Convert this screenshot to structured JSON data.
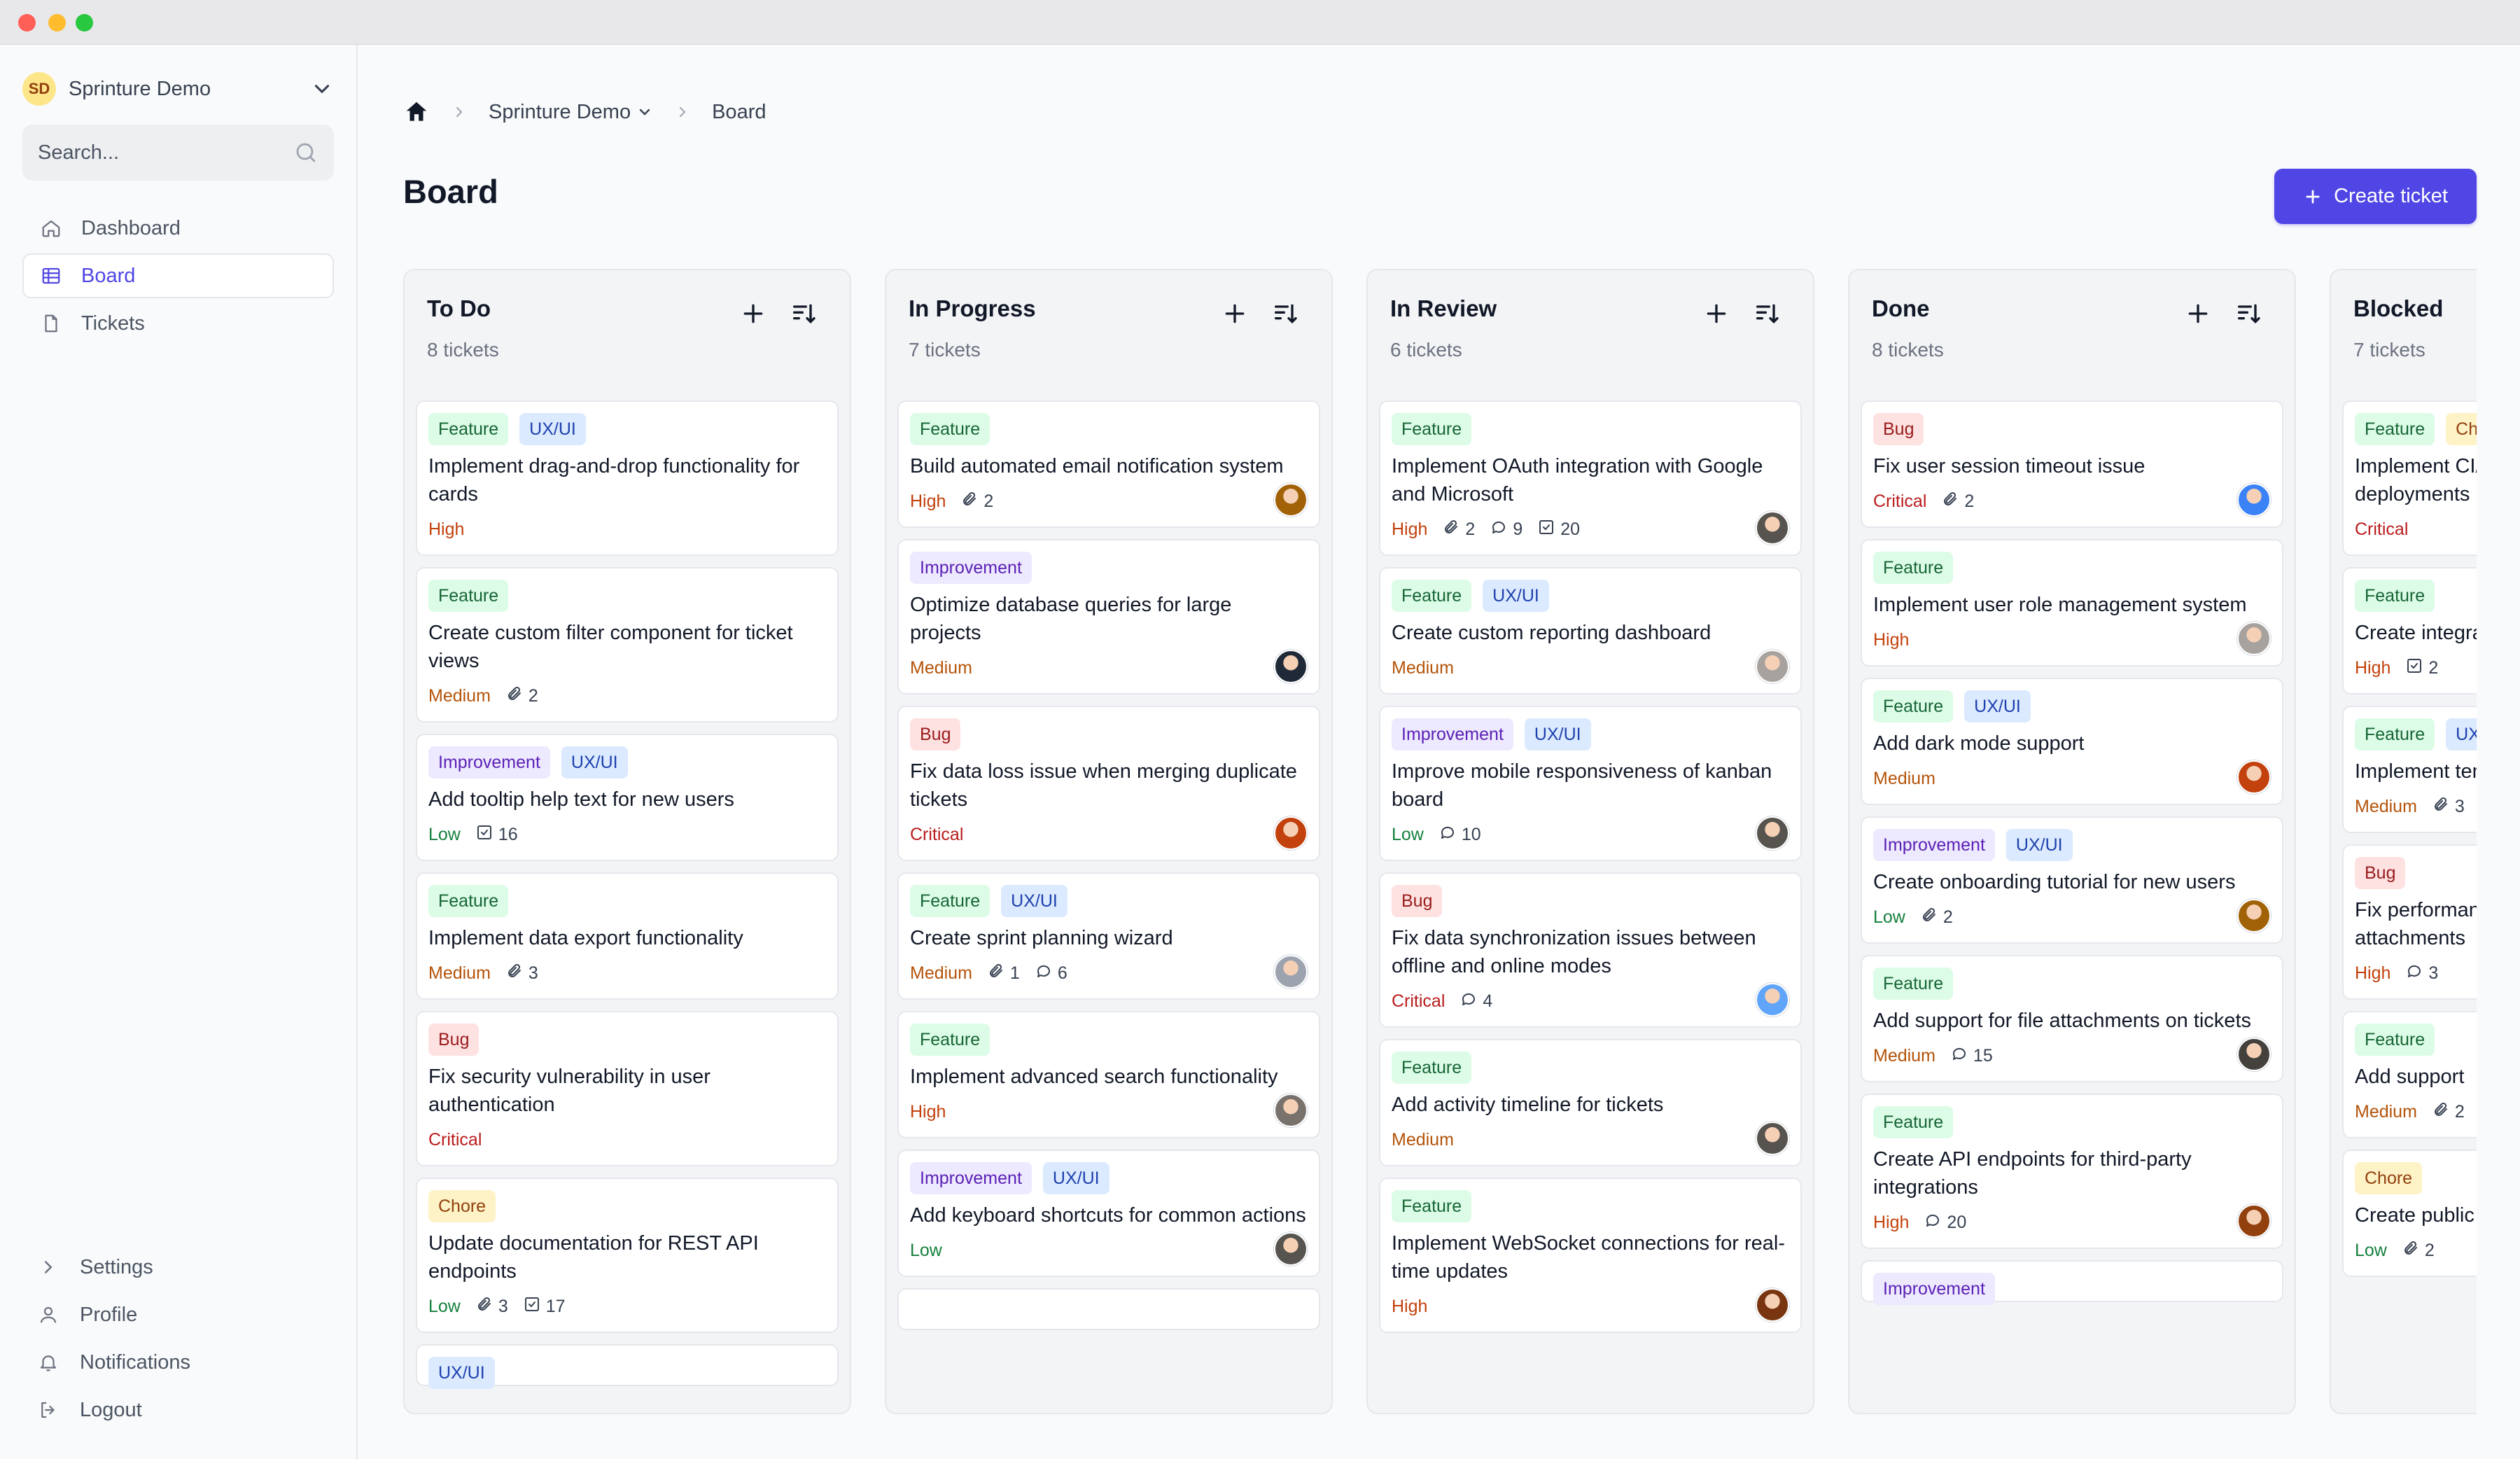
{
  "workspace": {
    "initials": "SD",
    "name": "Sprinture Demo"
  },
  "search": {
    "placeholder": "Search..."
  },
  "nav": [
    {
      "label": "Dashboard",
      "icon": "home-icon",
      "active": false
    },
    {
      "label": "Board",
      "icon": "board-icon",
      "active": true
    },
    {
      "label": "Tickets",
      "icon": "document-icon",
      "active": false
    }
  ],
  "bottom_nav": [
    {
      "label": "Settings",
      "icon": "chevron-right-icon"
    },
    {
      "label": "Profile",
      "icon": "user-icon"
    },
    {
      "label": "Notifications",
      "icon": "bell-icon"
    },
    {
      "label": "Logout",
      "icon": "logout-icon"
    }
  ],
  "breadcrumb": {
    "project": "Sprinture Demo",
    "current": "Board"
  },
  "page": {
    "title": "Board",
    "create_label": "Create ticket"
  },
  "colors": {
    "accent": "#4f46e5"
  },
  "columns": [
    {
      "title": "To Do",
      "count": "8 tickets",
      "cards": [
        {
          "tags": [
            "Feature",
            "UX/UI"
          ],
          "title": "Implement drag-and-drop functionality for cards",
          "priority": "High"
        },
        {
          "tags": [
            "Feature"
          ],
          "title": "Create custom filter component for ticket views",
          "priority": "Medium",
          "attachments": "2"
        },
        {
          "tags": [
            "Improvement",
            "UX/UI"
          ],
          "title": "Add tooltip help text for new users",
          "priority": "Low",
          "subtasks": "16"
        },
        {
          "tags": [
            "Feature"
          ],
          "title": "Implement data export functionality",
          "priority": "Medium",
          "attachments": "3"
        },
        {
          "tags": [
            "Bug"
          ],
          "title": "Fix security vulnerability in user authentication",
          "priority": "Critical"
        },
        {
          "tags": [
            "Chore"
          ],
          "title": "Update documentation for REST API endpoints",
          "priority": "Low",
          "attachments": "3",
          "subtasks": "17"
        },
        {
          "tags": [
            "UX/UI"
          ],
          "title": "",
          "priority": ""
        }
      ]
    },
    {
      "title": "In Progress",
      "count": "7 tickets",
      "cards": [
        {
          "tags": [
            "Feature"
          ],
          "title": "Build automated email notification system",
          "priority": "High",
          "attachments": "2",
          "avatar": "#a16207"
        },
        {
          "tags": [
            "Improvement"
          ],
          "title": "Optimize database queries for large projects",
          "priority": "Medium",
          "avatar": "#1f2937"
        },
        {
          "tags": [
            "Bug"
          ],
          "title": "Fix data loss issue when merging duplicate tickets",
          "priority": "Critical",
          "avatar": "#c2410c"
        },
        {
          "tags": [
            "Feature",
            "UX/UI"
          ],
          "title": "Create sprint planning wizard",
          "priority": "Medium",
          "attachments": "1",
          "comments": "6",
          "avatar": "#9ca3af"
        },
        {
          "tags": [
            "Feature"
          ],
          "title": "Implement advanced search functionality",
          "priority": "High",
          "avatar": "#78716c"
        },
        {
          "tags": [
            "Improvement",
            "UX/UI"
          ],
          "title": "Add keyboard shortcuts for common actions",
          "priority": "Low",
          "avatar": "#57534e"
        },
        {
          "tags": [],
          "title": "",
          "priority": ""
        }
      ]
    },
    {
      "title": "In Review",
      "count": "6 tickets",
      "cards": [
        {
          "tags": [
            "Feature"
          ],
          "title": "Implement OAuth integration with Google and Microsoft",
          "priority": "High",
          "attachments": "2",
          "comments": "9",
          "subtasks": "20",
          "avatar": "#57534e"
        },
        {
          "tags": [
            "Feature",
            "UX/UI"
          ],
          "title": "Create custom reporting dashboard",
          "priority": "Medium",
          "avatar": "#a8a29e"
        },
        {
          "tags": [
            "Improvement",
            "UX/UI"
          ],
          "title": "Improve mobile responsiveness of kanban board",
          "priority": "Low",
          "comments": "10",
          "avatar": "#57534e"
        },
        {
          "tags": [
            "Bug"
          ],
          "title": "Fix data synchronization issues between offline and online modes",
          "priority": "Critical",
          "comments": "4",
          "avatar": "#60a5fa"
        },
        {
          "tags": [
            "Feature"
          ],
          "title": "Add activity timeline for tickets",
          "priority": "Medium",
          "avatar": "#57534e"
        },
        {
          "tags": [
            "Feature"
          ],
          "title": "Implement WebSocket connections for real-time updates",
          "priority": "High",
          "avatar": "#78350f"
        }
      ]
    },
    {
      "title": "Done",
      "count": "8 tickets",
      "cards": [
        {
          "tags": [
            "Bug"
          ],
          "title": "Fix user session timeout issue",
          "priority": "Critical",
          "attachments": "2",
          "avatar": "#3b82f6"
        },
        {
          "tags": [
            "Feature"
          ],
          "title": "Implement user role management system",
          "priority": "High",
          "avatar": "#a8a29e"
        },
        {
          "tags": [
            "Feature",
            "UX/UI"
          ],
          "title": "Add dark mode support",
          "priority": "Medium",
          "avatar": "#c2410c"
        },
        {
          "tags": [
            "Improvement",
            "UX/UI"
          ],
          "title": "Create onboarding tutorial for new users",
          "priority": "Low",
          "attachments": "2",
          "avatar": "#a16207"
        },
        {
          "tags": [
            "Feature"
          ],
          "title": "Add support for file attachments on tickets",
          "priority": "Medium",
          "comments": "15",
          "avatar": "#44403c"
        },
        {
          "tags": [
            "Feature"
          ],
          "title": "Create API endpoints for third-party integrations",
          "priority": "High",
          "comments": "20",
          "avatar": "#92400e"
        },
        {
          "tags": [
            "Improvement"
          ],
          "title": "",
          "priority": ""
        }
      ]
    },
    {
      "title": "Blocked",
      "count": "7 tickets",
      "cards": [
        {
          "tags": [
            "Feature",
            "Chore"
          ],
          "title": "Implement CI/CD pipeline for automated deployments",
          "priority": "Critical"
        },
        {
          "tags": [
            "Feature"
          ],
          "title": "Create integration with external systems",
          "priority": "High",
          "subtasks": "2"
        },
        {
          "tags": [
            "Feature",
            "UX/UI"
          ],
          "title": "Implement template system",
          "priority": "Medium",
          "attachments": "3"
        },
        {
          "tags": [
            "Bug"
          ],
          "title": "Fix performance issues with large attachments",
          "priority": "High",
          "comments": "3"
        },
        {
          "tags": [
            "Feature"
          ],
          "title": "Add support",
          "priority": "Medium",
          "attachments": "2"
        },
        {
          "tags": [
            "Chore"
          ],
          "title": "Create public",
          "priority": "Low",
          "attachments": "2"
        }
      ]
    }
  ]
}
